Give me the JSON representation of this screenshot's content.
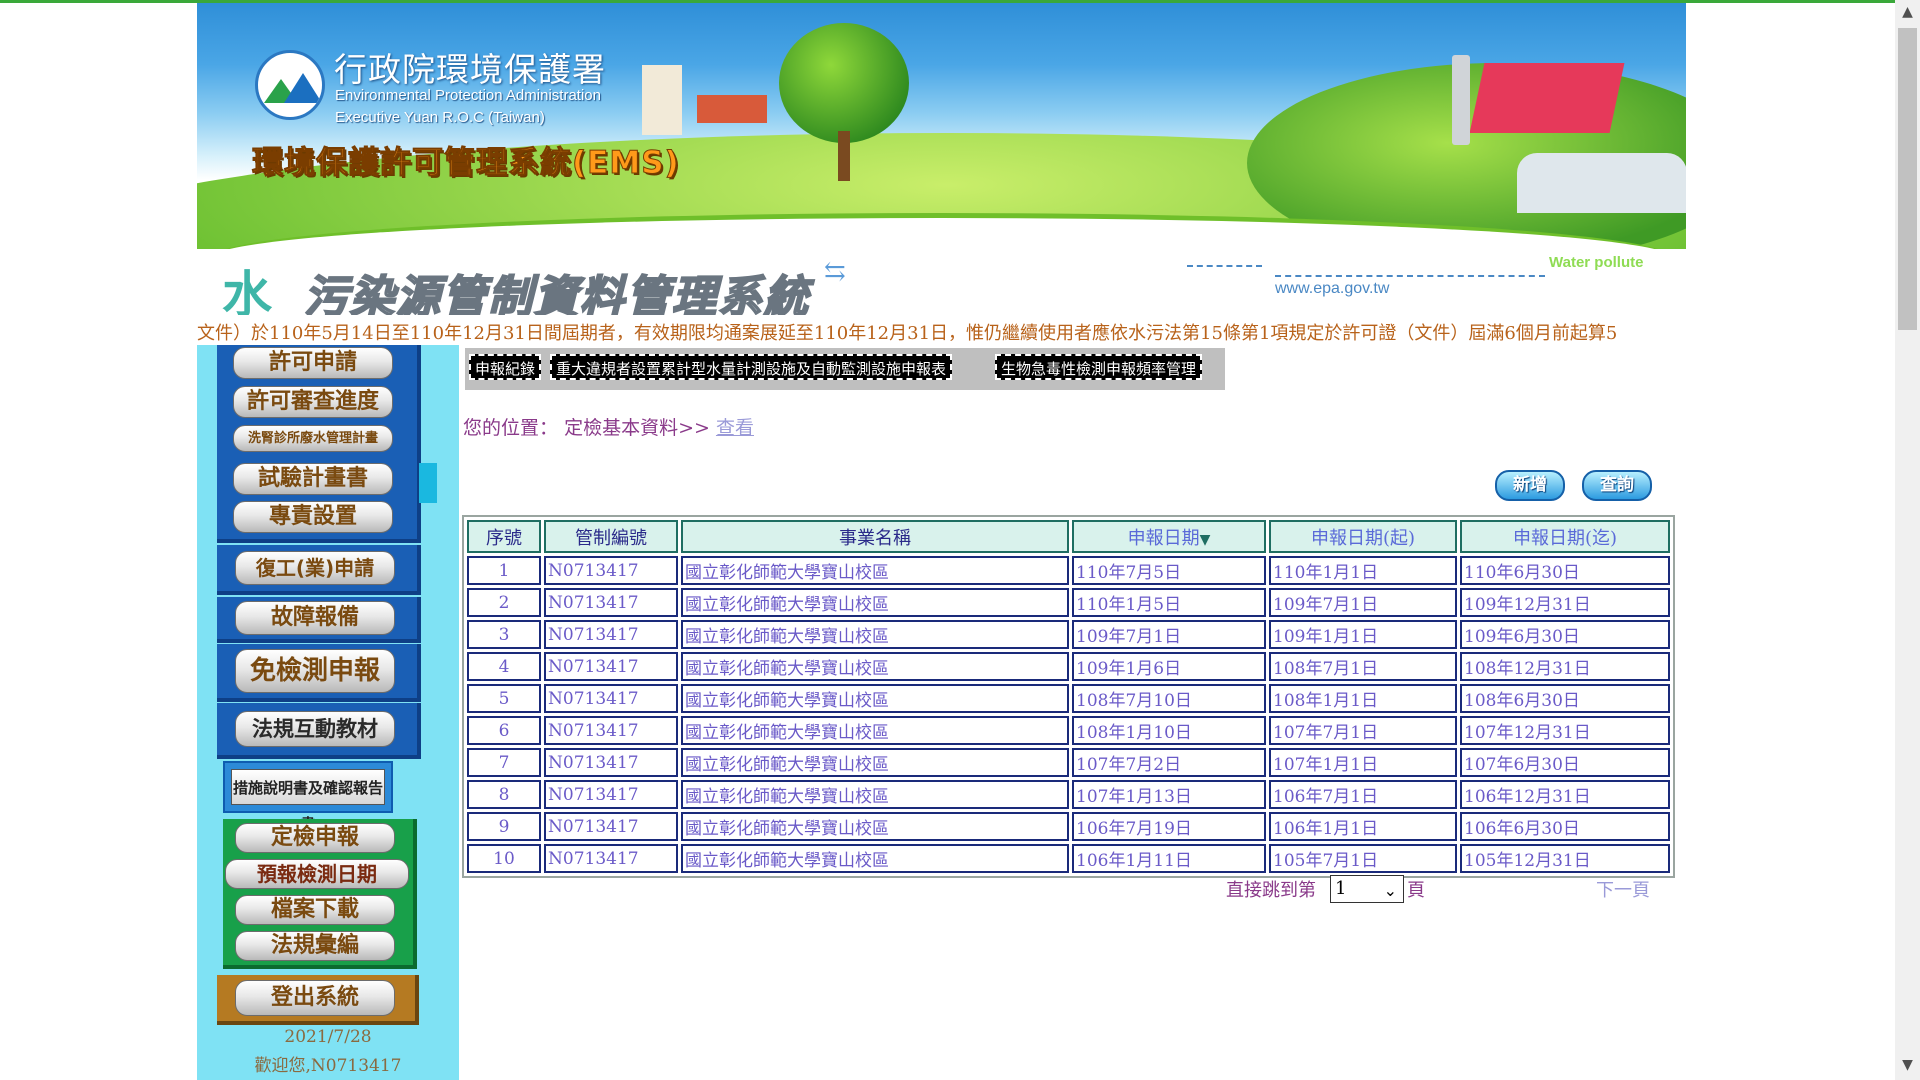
{
  "header": {
    "agency_cn": "行政院環境保護署",
    "agency_en_1": "Environmental Protection Administration",
    "agency_en_2": "Executive Yuan R.O.C (Taiwan)",
    "system_title": "環境保護許可管理系統(EMS)"
  },
  "subheader": {
    "water_char": "水",
    "title": "污染源管制資料管理系統",
    "water_polluter": "Water pollute",
    "url": "www.epa.gov.tw"
  },
  "marquee": "文件）於110年5月14日至110年12月31日間屆期者，有效期限均通案展延至110年12月31日，惟仍繼續使用者應依水污法第15條第1項規定於許可證（文件）屆滿6個月前起算5",
  "sidebar": {
    "group1": [
      "許可申請",
      "許可審查進度",
      "洗腎診所廢水管理計畫",
      "試驗計畫書",
      "專責設置"
    ],
    "resume": "復工(業)申請",
    "fault": "故障報備",
    "exempt": "免檢測申報",
    "regulation": "法規互動教材",
    "measure_report": "措施說明書及確認報告書",
    "group2": [
      "定檢申報",
      "預報檢測日期",
      "檔案下載",
      "法規彙編"
    ],
    "logout": "登出系統",
    "date": "2021/7/28",
    "welcome": "歡迎您,N0713417"
  },
  "tabs": [
    "申報紀錄",
    "重大違規者設置累計型水量計測設施及自動監測設施申報表",
    "生物急毒性檢測申報頻率管理"
  ],
  "breadcrumb": {
    "prefix": "您的位置：",
    "path": "定檢基本資料>>",
    "link": "查看"
  },
  "actions": {
    "add": "新增",
    "query": "查詢"
  },
  "table": {
    "headers": [
      "序號",
      "管制編號",
      "事業名稱",
      "申報日期",
      "申報日期(起)",
      "申報日期(迄)"
    ],
    "sort_indicator": "▼",
    "rows": [
      [
        "1",
        "N0713417",
        "國立彰化師範大學寶山校區",
        "110年7月5日",
        "110年1月1日",
        "110年6月30日"
      ],
      [
        "2",
        "N0713417",
        "國立彰化師範大學寶山校區",
        "110年1月5日",
        "109年7月1日",
        "109年12月31日"
      ],
      [
        "3",
        "N0713417",
        "國立彰化師範大學寶山校區",
        "109年7月1日",
        "109年1月1日",
        "109年6月30日"
      ],
      [
        "4",
        "N0713417",
        "國立彰化師範大學寶山校區",
        "109年1月6日",
        "108年7月1日",
        "108年12月31日"
      ],
      [
        "5",
        "N0713417",
        "國立彰化師範大學寶山校區",
        "108年7月10日",
        "108年1月1日",
        "108年6月30日"
      ],
      [
        "6",
        "N0713417",
        "國立彰化師範大學寶山校區",
        "108年1月10日",
        "107年7月1日",
        "107年12月31日"
      ],
      [
        "7",
        "N0713417",
        "國立彰化師範大學寶山校區",
        "107年7月2日",
        "107年1月1日",
        "107年6月30日"
      ],
      [
        "8",
        "N0713417",
        "國立彰化師範大學寶山校區",
        "107年1月13日",
        "106年7月1日",
        "106年12月31日"
      ],
      [
        "9",
        "N0713417",
        "國立彰化師範大學寶山校區",
        "106年7月19日",
        "106年1月1日",
        "106年6月30日"
      ],
      [
        "10",
        "N0713417",
        "國立彰化師範大學寶山校區",
        "106年1月11日",
        "105年7月1日",
        "105年12月31日"
      ]
    ]
  },
  "pager": {
    "prefix": "直接跳到第",
    "selected": "1",
    "suffix": "頁",
    "next": "下一頁"
  },
  "icons": {
    "scroll_up": "chevron-up-icon",
    "scroll_down": "chevron-down-icon",
    "select": "chevron-down-icon"
  },
  "colors": {
    "sidebar_bg": "#7fe2f4",
    "marquee_text": "#b8621a",
    "table_link": "#6a5ac8"
  }
}
